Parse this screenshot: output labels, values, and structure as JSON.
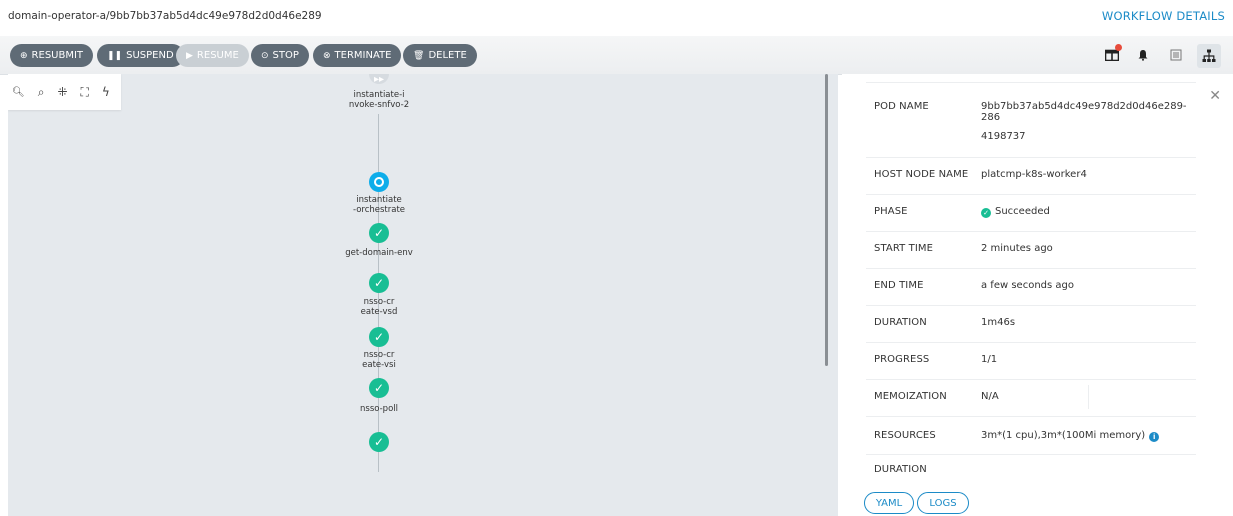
{
  "header": {
    "breadcrumb": "domain-operator-a/9bb7bb37ab5d4dc49e978d2d0d46e289",
    "details_link": "WORKFLOW DETAILS"
  },
  "toolbar": {
    "buttons": [
      {
        "label": "RESUBMIT",
        "icon": "plus-circle-icon",
        "enabled": true
      },
      {
        "label": "SUSPEND",
        "icon": "pause-icon",
        "enabled": true
      },
      {
        "label": "RESUME",
        "icon": "play-icon",
        "enabled": false
      },
      {
        "label": "STOP",
        "icon": "stop-circle-icon",
        "enabled": true
      },
      {
        "label": "TERMINATE",
        "icon": "times-circle-icon",
        "enabled": true
      },
      {
        "label": "DELETE",
        "icon": "trash-icon",
        "enabled": true
      }
    ],
    "right_icons": [
      "columns-icon",
      "bell-icon",
      "list-icon",
      "sitemap-icon"
    ]
  },
  "graph": {
    "tools": [
      "search-icon",
      "expand-icon",
      "fullscreen-icon",
      "bolt-icon"
    ],
    "nodes": [
      {
        "label": "instantiate-i\nnvoke-snfvo-2",
        "status": "skipped"
      },
      {
        "label": "instantiate\n-orchestrate",
        "status": "running"
      },
      {
        "label": "get-domain-env",
        "status": "succeeded"
      },
      {
        "label": "nsso-cr\neate-vsd",
        "status": "succeeded"
      },
      {
        "label": "nsso-cr\neate-vsi",
        "status": "succeeded"
      },
      {
        "label": "nsso-poll",
        "status": "succeeded"
      },
      {
        "label": "",
        "status": "succeeded"
      }
    ]
  },
  "panel": {
    "rows": [
      {
        "key": "POD NAME",
        "value": "9bb7bb37ab5d4dc49e978d2d0d46e289-286",
        "value2": "4198737"
      },
      {
        "key": "HOST NODE NAME",
        "value": "platcmp-k8s-worker4"
      },
      {
        "key": "PHASE",
        "value": "Succeeded"
      },
      {
        "key": "START TIME",
        "value": "2 minutes ago"
      },
      {
        "key": "END TIME",
        "value": "a few seconds ago"
      },
      {
        "key": "DURATION",
        "value": "1m46s"
      },
      {
        "key": "PROGRESS",
        "value": "1/1"
      },
      {
        "key": "MEMOIZATION",
        "value": "N/A"
      },
      {
        "key": "RESOURCES",
        "value": "3m*(1 cpu),3m*(100Mi memory)"
      },
      {
        "key": "DURATION",
        "value": ""
      }
    ],
    "yaml_label": "YAML",
    "logs_label": "LOGS"
  },
  "colors": {
    "accent": "#1c8bc7",
    "success": "#18be94",
    "running": "#0dadea",
    "button": "#5f6b76"
  }
}
